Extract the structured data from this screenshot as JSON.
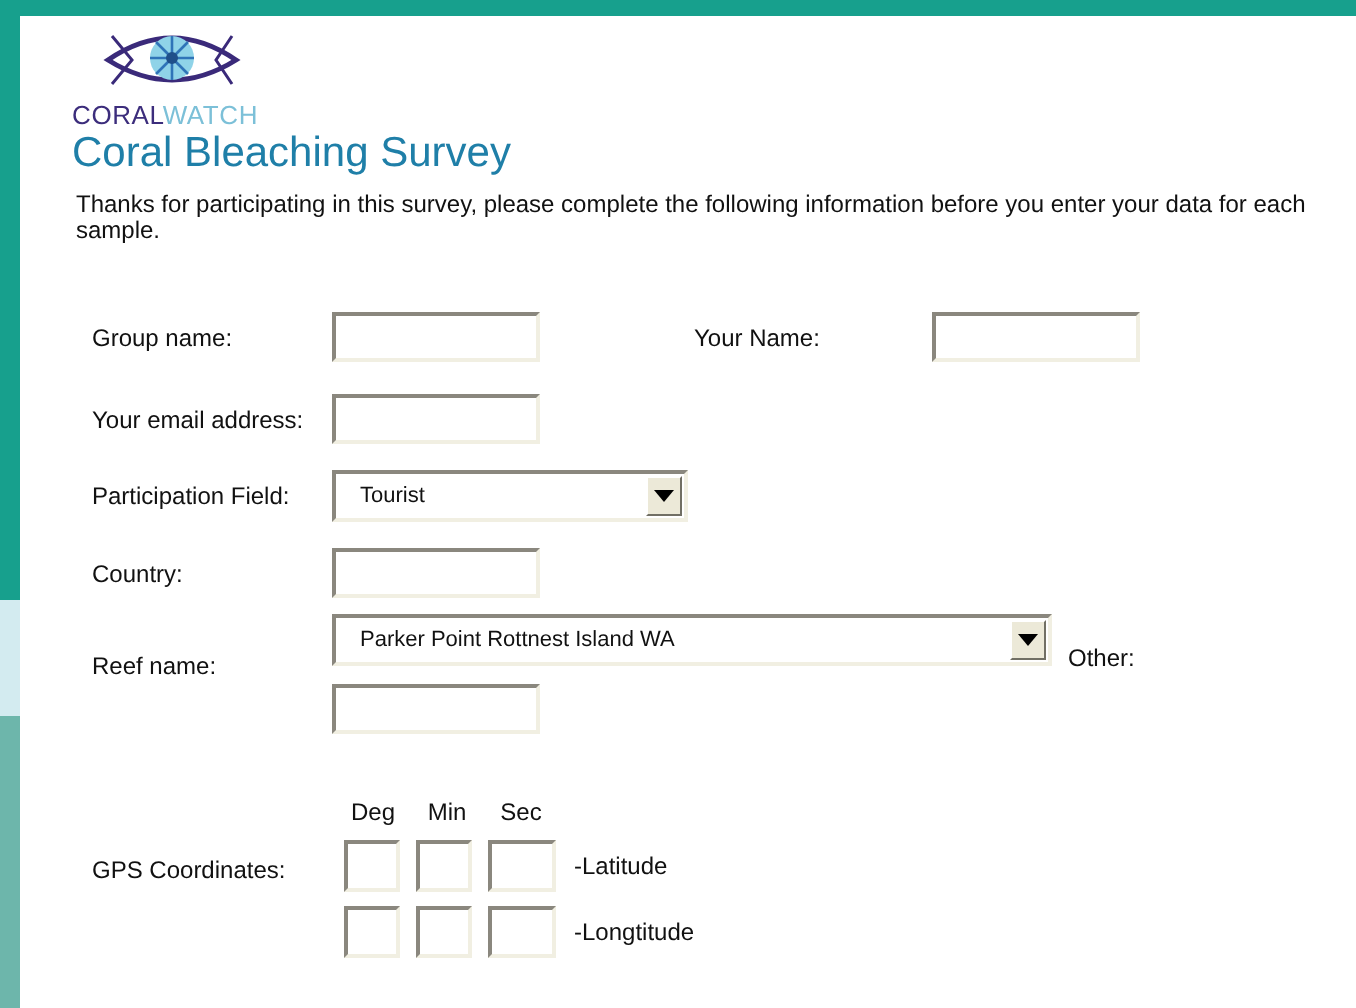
{
  "logo": {
    "parts": [
      "CORAL",
      "WATCH"
    ]
  },
  "title": "Coral Bleaching Survey",
  "intro": "Thanks for participating in this survey, please complete the following information before you enter your data for each sample.",
  "group_name": {
    "label": "Group name:"
  },
  "your_name": {
    "label": "Your Name:"
  },
  "email": {
    "label": "Your email address:"
  },
  "participation": {
    "label": "Participation Field:",
    "value": "Tourist"
  },
  "country": {
    "label": "Country:"
  },
  "reef": {
    "label": "Reef name:",
    "value": "Parker Point Rottnest Island WA",
    "other_label": "Other:"
  },
  "gps": {
    "label": "GPS Coordinates:",
    "columns": [
      "Deg",
      "Min",
      "Sec"
    ],
    "rows": [
      {
        "label": "-Latitude"
      },
      {
        "label": "-Longtitude"
      }
    ]
  }
}
